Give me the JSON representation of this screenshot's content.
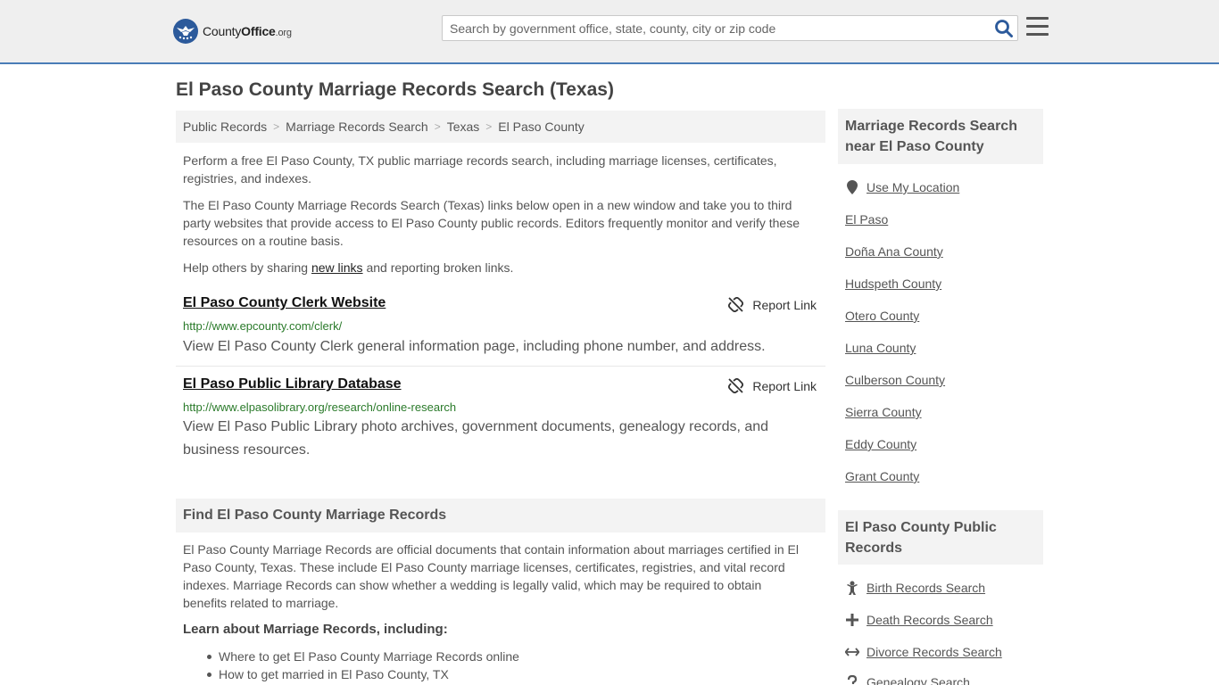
{
  "header": {
    "logo_name": "CountyOffice",
    "logo_county": "County",
    "logo_office": "Office",
    "logo_tld": ".org",
    "search_placeholder": "Search by government office, state, county, city or zip code",
    "icons": {
      "search": "search-icon",
      "menu": "hamburger-menu-icon"
    },
    "accent_color": "#4a7db7"
  },
  "page": {
    "title": "El Paso County Marriage Records Search (Texas)"
  },
  "breadcrumb": [
    "Public Records",
    "Marriage Records Search",
    "Texas",
    "El Paso County"
  ],
  "intro": {
    "p1": "Perform a free El Paso County, TX public marriage records search, including marriage licenses, certificates, registries, and indexes.",
    "p2": "The El Paso County Marriage Records Search (Texas) links below open in a new window and take you to third party websites that provide access to El Paso County public records. Editors frequently monitor and verify these resources on a routine basis.",
    "p3_before": "Help others by sharing ",
    "p3_link": "new links",
    "p3_after": " and reporting broken links."
  },
  "results": [
    {
      "title": "El Paso County Clerk Website",
      "url": "http://www.epcounty.com/clerk/",
      "description": "View El Paso County Clerk general information page, including phone number, and address.",
      "report_label": "Report Link"
    },
    {
      "title": "El Paso Public Library Database",
      "url": "http://www.elpasolibrary.org/research/online-research",
      "description": "View El Paso Public Library photo archives, government documents, genealogy records, and business resources.",
      "report_label": "Report Link"
    }
  ],
  "find_section": {
    "heading": "Find El Paso County Marriage Records",
    "body": "El Paso County Marriage Records are official documents that contain information about marriages certified in El Paso County, Texas. These include El Paso County marriage licenses, certificates, registries, and vital record indexes. Marriage Records can show whether a wedding is legally valid, which may be required to obtain benefits related to marriage.",
    "learn_heading": "Learn about Marriage Records, including:",
    "learn_items": [
      "Where to get El Paso County Marriage Records online",
      "How to get married in El Paso County, TX"
    ]
  },
  "sidebar": {
    "nearby_heading": "Marriage Records Search near El Paso County",
    "use_location": "Use My Location",
    "nearby": [
      "El Paso",
      "Doña Ana County",
      "Hudspeth County",
      "Otero County",
      "Luna County",
      "Culberson County",
      "Sierra County",
      "Eddy County",
      "Grant County"
    ],
    "public_heading": "El Paso County Public Records",
    "public_links": [
      {
        "label": "Birth Records Search",
        "icon": "baby-icon"
      },
      {
        "label": "Death Records Search",
        "icon": "cross-icon"
      },
      {
        "label": "Divorce Records Search",
        "icon": "split-arrows-icon"
      },
      {
        "label": "Genealogy Search",
        "icon": "question-icon"
      }
    ]
  }
}
